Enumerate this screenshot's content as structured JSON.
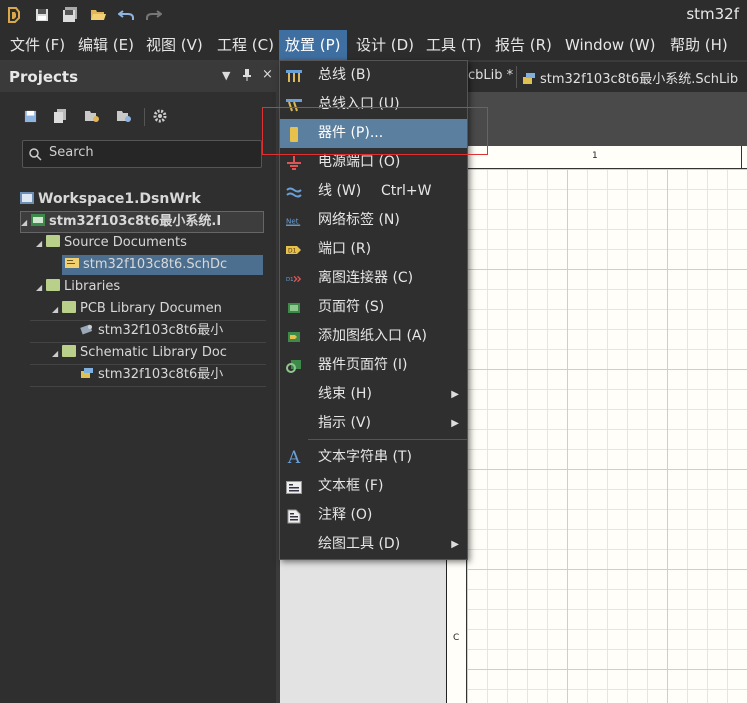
{
  "title_bar": {
    "app_title": "stm32f",
    "icons": [
      "app-logo-icon",
      "save-icon",
      "save-all-icon",
      "open-folder-icon",
      "undo-icon",
      "redo-icon"
    ]
  },
  "menu": {
    "items": [
      {
        "label": "文件 (F)"
      },
      {
        "label": "编辑 (E)"
      },
      {
        "label": "视图 (V)"
      },
      {
        "label": "工程 (C)"
      },
      {
        "label": "放置 (P)"
      },
      {
        "label": "设计 (D)"
      },
      {
        "label": "工具 (T)"
      },
      {
        "label": "报告 (R)"
      },
      {
        "label": "Window (W)"
      },
      {
        "label": "帮助 (H)"
      }
    ]
  },
  "projects_panel": {
    "title": "Projects",
    "search_placeholder": "Search",
    "tree": [
      {
        "label": "Workspace1.DsnWrk"
      },
      {
        "label": "stm32f103c8t6最小系统.I"
      },
      {
        "label": "Source Documents"
      },
      {
        "label": "stm32f103c8t6.SchDc"
      },
      {
        "label": "Libraries"
      },
      {
        "label": "PCB Library Documen"
      },
      {
        "label": "stm32f103c8t6最小"
      },
      {
        "label": "Schematic Library Doc"
      },
      {
        "label": "stm32f103c8t6最小"
      }
    ]
  },
  "tabs": [
    {
      "label": "cbLib *"
    },
    {
      "label": "stm32f103c8t6最小系统.SchLib"
    }
  ],
  "sheet": {
    "ruler_top": "1",
    "ruler_left": "C"
  },
  "place_menu": {
    "items": [
      {
        "label": "总线 (B)",
        "shortcut": "",
        "icon": "bus-icon",
        "submenu": false
      },
      {
        "label": "总线入口 (U)",
        "shortcut": "",
        "icon": "bus-entry-icon",
        "submenu": false
      },
      {
        "label": "器件 (P)...",
        "shortcut": "",
        "icon": "part-icon",
        "submenu": false,
        "highlighted": true
      },
      {
        "label": "电源端口 (O)",
        "shortcut": "",
        "icon": "power-port-icon",
        "submenu": false
      },
      {
        "label": "线 (W)",
        "shortcut": "Ctrl+W",
        "icon": "wire-icon",
        "submenu": false
      },
      {
        "label": "网络标签 (N)",
        "shortcut": "",
        "icon": "net-label-icon",
        "submenu": false
      },
      {
        "label": "端口 (R)",
        "shortcut": "",
        "icon": "port-icon",
        "submenu": false
      },
      {
        "label": "离图连接器 (C)",
        "shortcut": "",
        "icon": "off-sheet-connector-icon",
        "submenu": false
      },
      {
        "label": "页面符 (S)",
        "shortcut": "",
        "icon": "sheet-symbol-icon",
        "submenu": false
      },
      {
        "label": "添加图纸入口 (A)",
        "shortcut": "",
        "icon": "sheet-entry-icon",
        "submenu": false
      },
      {
        "label": "器件页面符 (I)",
        "shortcut": "",
        "icon": "device-sheet-symbol-icon",
        "submenu": false
      },
      {
        "label": "线束 (H)",
        "shortcut": "",
        "icon": "",
        "submenu": true
      },
      {
        "label": "指示 (V)",
        "shortcut": "",
        "icon": "",
        "submenu": true
      },
      {
        "label": "文本字符串 (T)",
        "shortcut": "",
        "icon": "text-string-icon",
        "submenu": false
      },
      {
        "label": "文本框 (F)",
        "shortcut": "",
        "icon": "text-frame-icon",
        "submenu": false
      },
      {
        "label": "注释 (O)",
        "shortcut": "",
        "icon": "note-icon",
        "submenu": false
      },
      {
        "label": "绘图工具 (D)",
        "shortcut": "",
        "icon": "",
        "submenu": true
      }
    ]
  },
  "colors": {
    "menu_active": "#3f6fa0",
    "item_highlight": "#5b7f9e",
    "annotation_box": "#e03030"
  }
}
